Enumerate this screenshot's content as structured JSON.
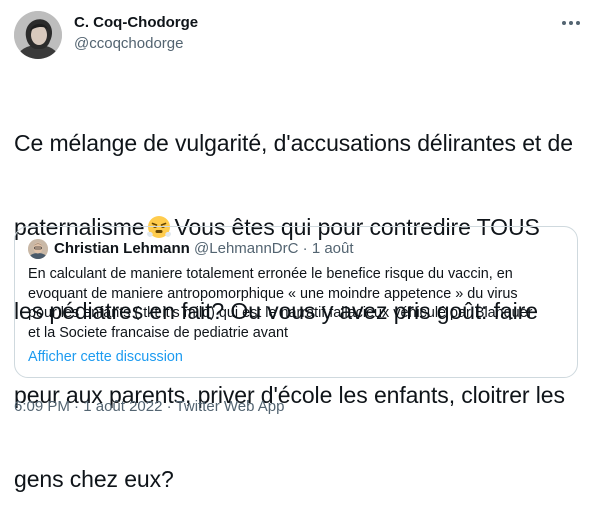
{
  "author": {
    "name": "C. Coq-Chodorge",
    "handle": "@ccoqchodorge"
  },
  "tweet": {
    "lines": [
      "Ce mélange de vulgarité, d'accusations délirantes et de",
      "paternalisme",
      "Vous êtes qui pour contredire TOUS",
      "les pédiatres en fait? Ou vous y avez pris goût: faire",
      "peur aux parents, priver d'école les enfants, cloitrer les",
      "gens chez eux?"
    ],
    "emoji": "face-with-steam-from-nose"
  },
  "quoted": {
    "name": "Christian Lehmann",
    "handle": "@LehmannDrC",
    "separator": "·",
    "date": "1 août",
    "lines": [
      "En calculant de maniere totalement erronée le benefice risque du vaccin, en",
      "evoquant de maniere antropomorphique «  une moindre appetence » du virus",
      "pour les enfants ( tkt it’s mild) qui est le narratif fallacieux véhiculé par Blanquer",
      "et la Societe francaise de pediatrie avant"
    ],
    "show_thread": "Afficher cette discussion"
  },
  "meta": {
    "time": "6:09 PM",
    "sep1": "·",
    "date": "1 août 2022",
    "sep2": "·",
    "source": "Twitter Web App"
  },
  "colors": {
    "link": "#1d9bf0",
    "secondary_text": "#536471",
    "border": "#cfd9de"
  }
}
